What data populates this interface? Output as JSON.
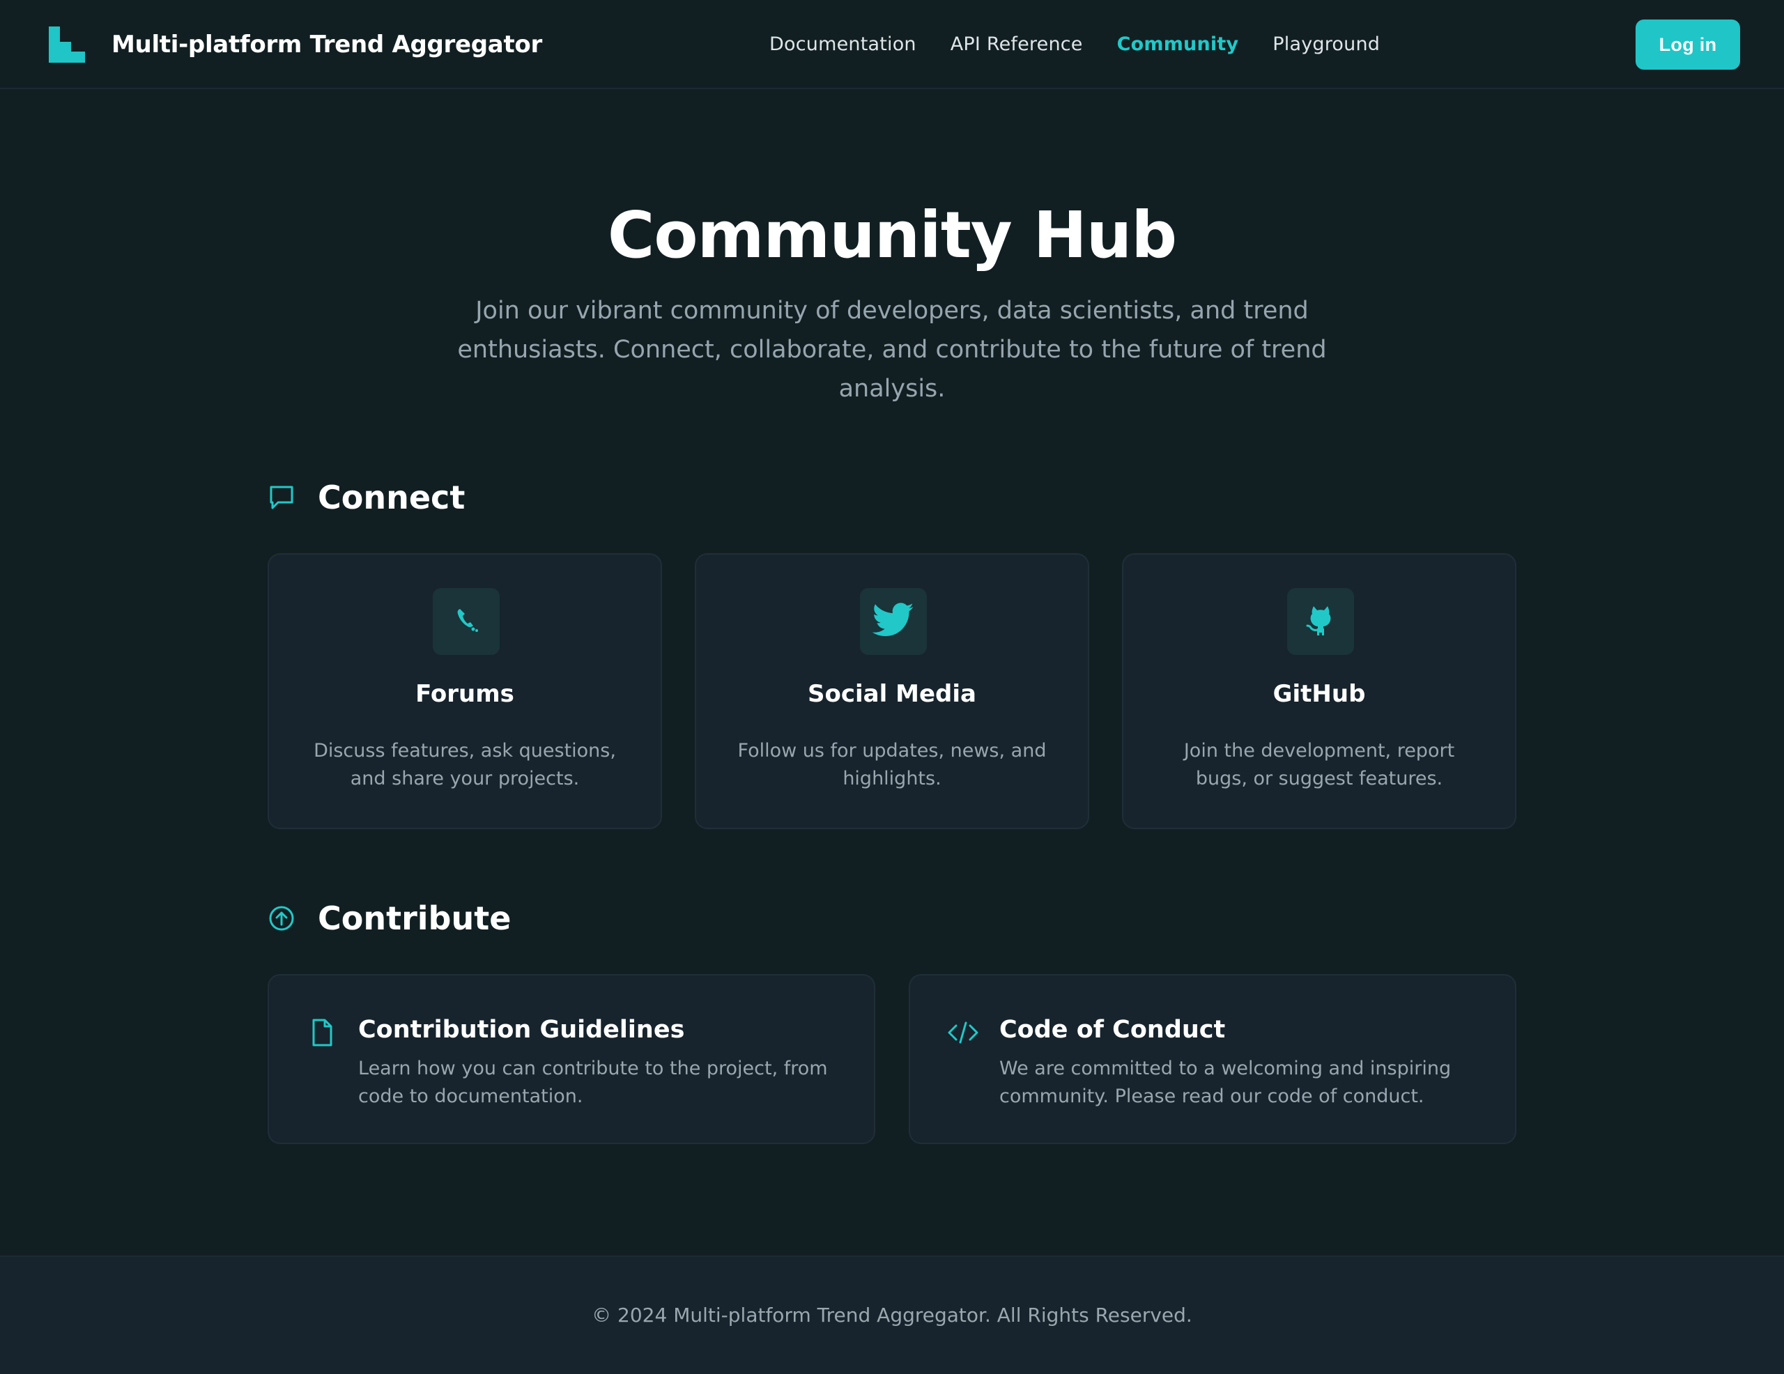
{
  "header": {
    "brand": "Multi-platform Trend Aggregator",
    "logo_icon": "stairs-logo-icon",
    "nav": [
      {
        "label": "Documentation",
        "active": false
      },
      {
        "label": "API Reference",
        "active": false
      },
      {
        "label": "Community",
        "active": true
      },
      {
        "label": "Playground",
        "active": false
      }
    ],
    "login_label": "Log in"
  },
  "hero": {
    "title": "Community Hub",
    "subtitle": "Join our vibrant community of developers, data scientists, and trend enthusiasts. Connect, collaborate, and contribute to the future of trend analysis."
  },
  "connect": {
    "title": "Connect",
    "icon": "chat-bubble-icon",
    "cards": [
      {
        "title": "Forums",
        "description": "Discuss features, ask questions, and share your projects.",
        "icon": "phone-icon"
      },
      {
        "title": "Social Media",
        "description": "Follow us for updates, news, and highlights.",
        "icon": "twitter-bird-icon"
      },
      {
        "title": "GitHub",
        "description": "Join the development, report bugs, or suggest features.",
        "icon": "github-octocat-icon"
      }
    ]
  },
  "contribute": {
    "title": "Contribute",
    "icon": "arrow-up-circle-icon",
    "cards": [
      {
        "title": "Contribution Guidelines",
        "description": "Learn how you can contribute to the project, from code to documentation.",
        "icon": "document-icon"
      },
      {
        "title": "Code of Conduct",
        "description": "We are committed to a welcoming and inspiring community. Please read our code of conduct.",
        "icon": "code-brackets-icon"
      }
    ]
  },
  "footer": {
    "text": "© 2024 Multi-platform Trend Aggregator. All Rights Reserved."
  },
  "colors": {
    "background": "#121f22",
    "card": "#17242d",
    "accent": "#22c8c8",
    "muted_text": "#99a6ae",
    "icon_tile": "#1a3439"
  }
}
